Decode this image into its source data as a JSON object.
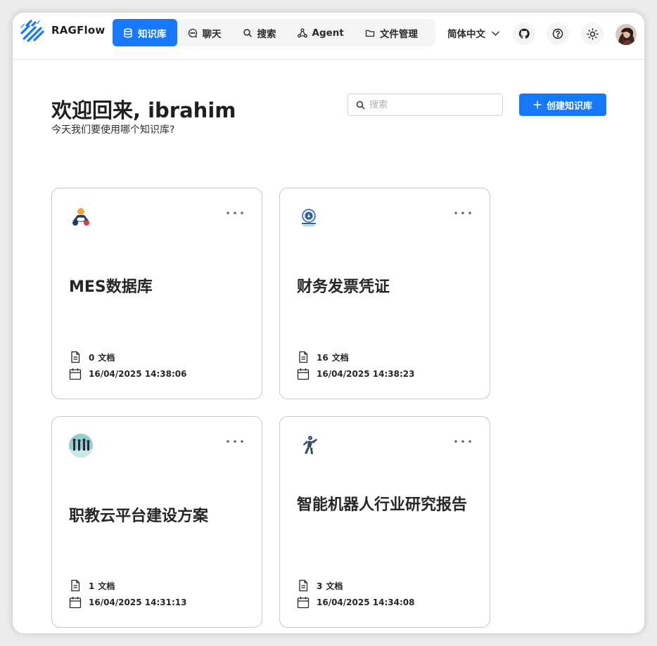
{
  "app": {
    "name": "RAGFlow"
  },
  "nav": {
    "items": [
      {
        "label": "知识库",
        "icon": "database-icon",
        "active": true
      },
      {
        "label": "聊天",
        "icon": "chat-bubble-icon",
        "active": false
      },
      {
        "label": "搜索",
        "icon": "search-icon",
        "active": false
      },
      {
        "label": "Agent",
        "icon": "agent-graph-icon",
        "active": false
      },
      {
        "label": "文件管理",
        "icon": "folder-icon",
        "active": false
      }
    ]
  },
  "header": {
    "language": "简体中文",
    "icons": [
      "github-icon",
      "help-icon",
      "theme-sun-icon"
    ]
  },
  "main": {
    "title": "欢迎回来, ibrahim",
    "subtitle": "今天我们要使用哪个知识库?",
    "search_placeholder": "搜索",
    "create_button": "创建知识库"
  },
  "knowledge_bases": [
    {
      "name": "MES数据库",
      "doc_count": "0",
      "doc_label": "文档",
      "updated": "16/04/2025 14:38:06",
      "icon": "mes-logo-icon"
    },
    {
      "name": "财务发票凭证",
      "doc_count": "16",
      "doc_label": "文档",
      "updated": "16/04/2025 14:38:23",
      "icon": "finance-badge-icon"
    },
    {
      "name": "职教云平台建设方案",
      "doc_count": "1",
      "doc_label": "文档",
      "updated": "16/04/2025 14:31:13",
      "icon": "people-circle-icon"
    },
    {
      "name": "智能机器人行业研究报告",
      "doc_count": "3",
      "doc_label": "文档",
      "updated": "16/04/2025 14:34:08",
      "icon": "robot-icon"
    }
  ],
  "colors": {
    "accent": "#1677ff",
    "nav_bg": "#f3f4f6",
    "card_border": "#c9c9c9"
  }
}
